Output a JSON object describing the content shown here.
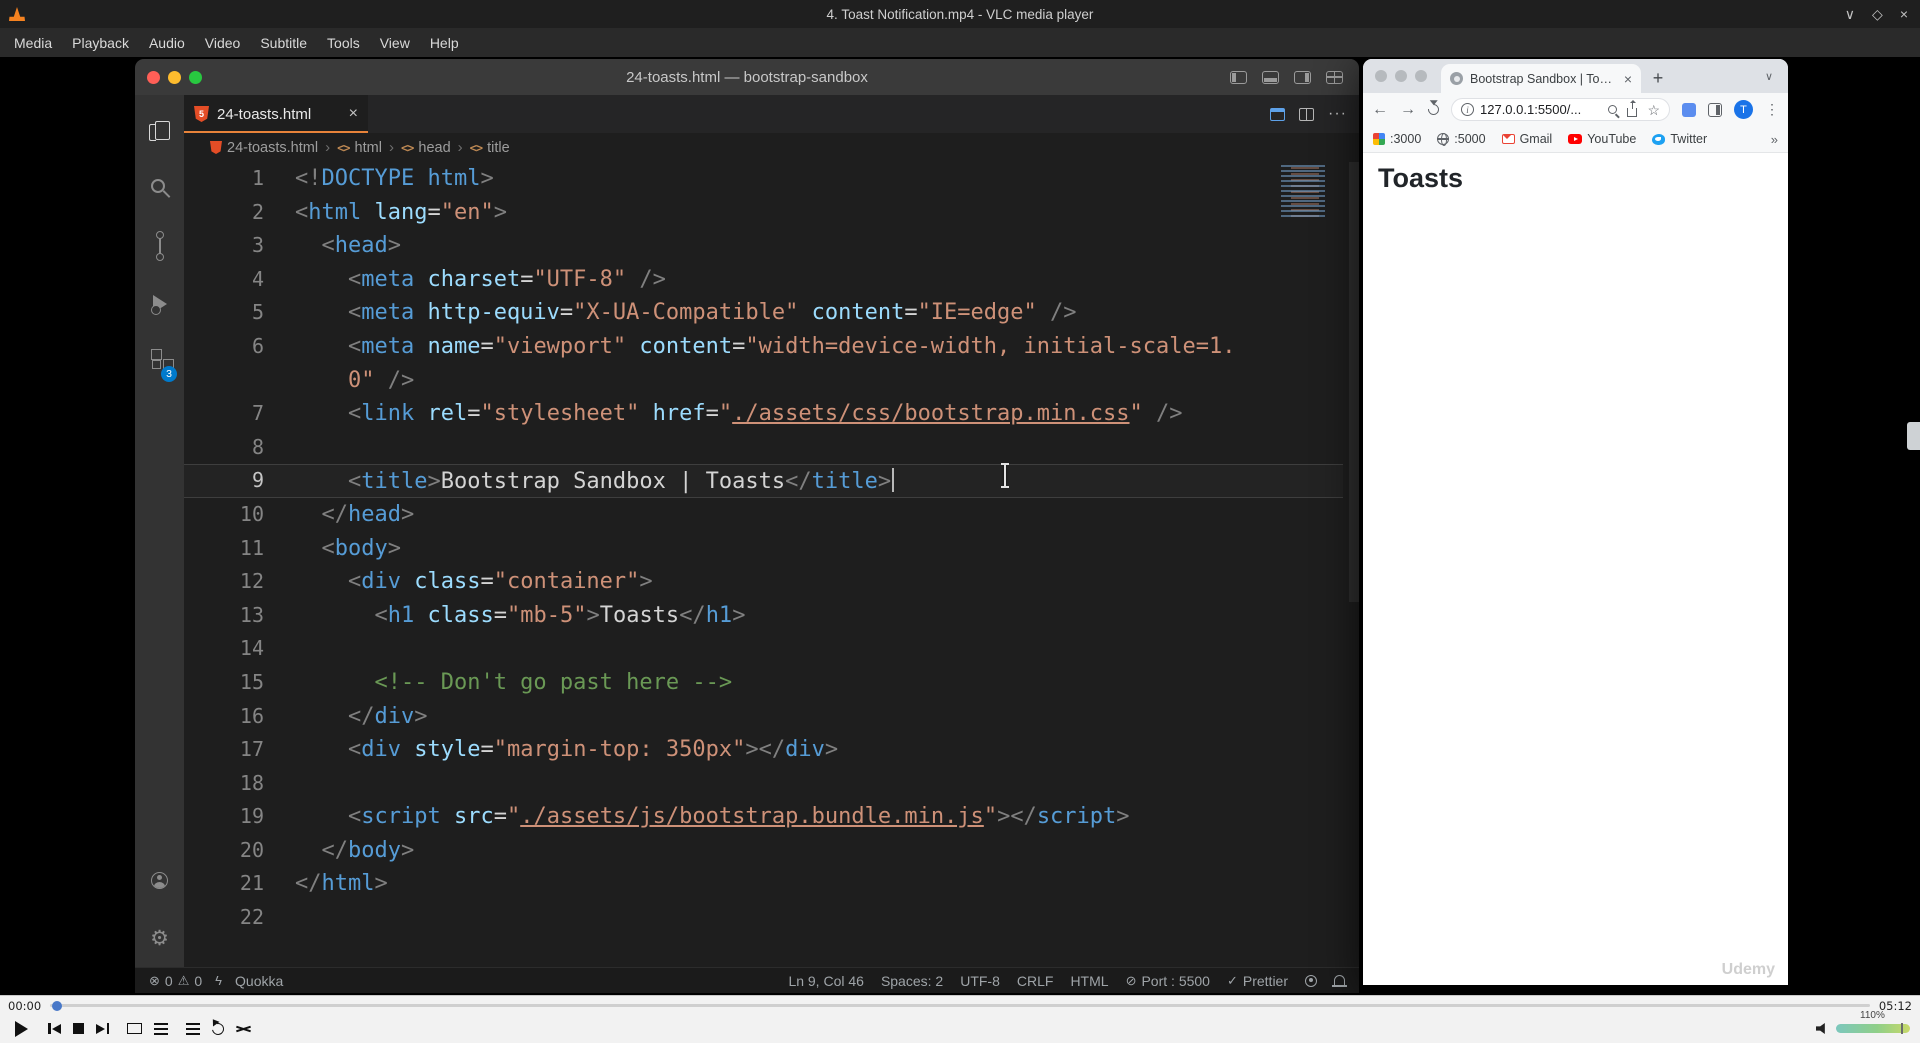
{
  "colors": {
    "tab-accent": "#e8833a",
    "badge-blue": "#007acc",
    "html-orange": "#e44d26",
    "avatar-blue": "#1a73e8",
    "youtube-red": "#ff0000",
    "twitter-blue": "#1da1f2",
    "gmail-red": "#ea4335",
    "cone-orange": "#f58220"
  },
  "vlc": {
    "window_title": "4. Toast Notification.mp4 - VLC media player",
    "menu": [
      "Media",
      "Playback",
      "Audio",
      "Video",
      "Subtitle",
      "Tools",
      "View",
      "Help"
    ],
    "window_controls": {
      "minimize": "∨",
      "maximize": "◇",
      "close": "×"
    },
    "time_elapsed": "00:00",
    "time_total": "05:12",
    "volume": "110%"
  },
  "vscode": {
    "window_title": "24-toasts.html — bootstrap-sandbox",
    "tab_label": "24-toasts.html",
    "breadcrumb": [
      "24-toasts.html",
      "html",
      "head",
      "title"
    ],
    "breadcrumb_separator": "›",
    "breadcrumb_tag_glyph": "<>",
    "extensions_badge": "3",
    "icons": {
      "close": "×",
      "more": "···",
      "gear": "⚙",
      "html5": "5"
    },
    "status_icons": {
      "error": "⊗",
      "warning": "⚠",
      "lightning": "ϟ",
      "circle-slash": "⊘",
      "check": "✓"
    },
    "status": {
      "errors": "0",
      "warnings": "0",
      "quokka": "Quokka",
      "right": [
        {
          "label": "Ln 9, Col 46"
        },
        {
          "label": "Spaces: 2"
        },
        {
          "label": "UTF-8"
        },
        {
          "label": "CRLF"
        },
        {
          "label": "HTML"
        },
        {
          "label": "Port : 5500",
          "icon": "circle-slash"
        },
        {
          "label": "Prettier",
          "icon": "check"
        }
      ]
    },
    "editor": {
      "rows": [
        {
          "n": "1",
          "t": [
            [
              "<!",
              "p"
            ],
            [
              "DOCTYPE html",
              "g"
            ],
            [
              ">",
              "p"
            ]
          ]
        },
        {
          "n": "2",
          "t": [
            [
              "<",
              "p"
            ],
            [
              "html",
              "g"
            ],
            [
              " ",
              "w"
            ],
            [
              "lang",
              "a"
            ],
            [
              "=",
              "w"
            ],
            [
              "\"en\"",
              "s"
            ],
            [
              ">",
              "p"
            ]
          ]
        },
        {
          "n": "3",
          "t": [
            [
              "  ",
              "w"
            ],
            [
              "<",
              "p"
            ],
            [
              "head",
              "g"
            ],
            [
              ">",
              "p"
            ]
          ]
        },
        {
          "n": "4",
          "t": [
            [
              "    ",
              "w"
            ],
            [
              "<",
              "p"
            ],
            [
              "meta",
              "g"
            ],
            [
              " ",
              "w"
            ],
            [
              "charset",
              "a"
            ],
            [
              "=",
              "w"
            ],
            [
              "\"UTF-8\"",
              "s"
            ],
            [
              " ",
              "w"
            ],
            [
              "/>",
              "p"
            ]
          ]
        },
        {
          "n": "5",
          "t": [
            [
              "    ",
              "w"
            ],
            [
              "<",
              "p"
            ],
            [
              "meta",
              "g"
            ],
            [
              " ",
              "w"
            ],
            [
              "http-equiv",
              "a"
            ],
            [
              "=",
              "w"
            ],
            [
              "\"X-UA-Compatible\"",
              "s"
            ],
            [
              " ",
              "w"
            ],
            [
              "content",
              "a"
            ],
            [
              "=",
              "w"
            ],
            [
              "\"IE=edge\"",
              "s"
            ],
            [
              " ",
              "w"
            ],
            [
              "/>",
              "p"
            ]
          ]
        },
        {
          "n": "6",
          "t": [
            [
              "    ",
              "w"
            ],
            [
              "<",
              "p"
            ],
            [
              "meta",
              "g"
            ],
            [
              " ",
              "w"
            ],
            [
              "name",
              "a"
            ],
            [
              "=",
              "w"
            ],
            [
              "\"viewport\"",
              "s"
            ],
            [
              " ",
              "w"
            ],
            [
              "content",
              "a"
            ],
            [
              "=",
              "w"
            ],
            [
              "\"width=device-width, initial-scale=1.",
              "s"
            ]
          ]
        },
        {
          "n": "",
          "t": [
            [
              "    ",
              "w"
            ],
            [
              "0\"",
              "s"
            ],
            [
              " ",
              "w"
            ],
            [
              "/>",
              "p"
            ]
          ]
        },
        {
          "n": "7",
          "t": [
            [
              "    ",
              "w"
            ],
            [
              "<",
              "p"
            ],
            [
              "link",
              "g"
            ],
            [
              " ",
              "w"
            ],
            [
              "rel",
              "a"
            ],
            [
              "=",
              "w"
            ],
            [
              "\"stylesheet\"",
              "s"
            ],
            [
              " ",
              "w"
            ],
            [
              "href",
              "a"
            ],
            [
              "=",
              "w"
            ],
            [
              "\"",
              "s"
            ],
            [
              "./assets/css/bootstrap.min.css",
              "l"
            ],
            [
              "\"",
              "s"
            ],
            [
              " ",
              "w"
            ],
            [
              "/>",
              "p"
            ]
          ]
        },
        {
          "n": "8",
          "t": []
        },
        {
          "n": "9",
          "active": true,
          "cursor": true,
          "t": [
            [
              "    ",
              "w"
            ],
            [
              "<",
              "p"
            ],
            [
              "title",
              "g"
            ],
            [
              ">",
              "p"
            ],
            [
              "Bootstrap Sandbox | Toasts",
              "x"
            ],
            [
              "</",
              "p"
            ],
            [
              "title",
              "g"
            ],
            [
              ">",
              "p"
            ]
          ]
        },
        {
          "n": "10",
          "t": [
            [
              "  ",
              "w"
            ],
            [
              "</",
              "p"
            ],
            [
              "head",
              "g"
            ],
            [
              ">",
              "p"
            ]
          ]
        },
        {
          "n": "11",
          "t": [
            [
              "  ",
              "w"
            ],
            [
              "<",
              "p"
            ],
            [
              "body",
              "g"
            ],
            [
              ">",
              "p"
            ]
          ]
        },
        {
          "n": "12",
          "t": [
            [
              "    ",
              "w"
            ],
            [
              "<",
              "p"
            ],
            [
              "div",
              "g"
            ],
            [
              " ",
              "w"
            ],
            [
              "class",
              "a"
            ],
            [
              "=",
              "w"
            ],
            [
              "\"container\"",
              "s"
            ],
            [
              ">",
              "p"
            ]
          ]
        },
        {
          "n": "13",
          "t": [
            [
              "      ",
              "w"
            ],
            [
              "<",
              "p"
            ],
            [
              "h1",
              "g"
            ],
            [
              " ",
              "w"
            ],
            [
              "class",
              "a"
            ],
            [
              "=",
              "w"
            ],
            [
              "\"mb-5\"",
              "s"
            ],
            [
              ">",
              "p"
            ],
            [
              "Toasts",
              "x"
            ],
            [
              "</",
              "p"
            ],
            [
              "h1",
              "g"
            ],
            [
              ">",
              "p"
            ]
          ]
        },
        {
          "n": "14",
          "t": []
        },
        {
          "n": "15",
          "t": [
            [
              "      ",
              "w"
            ],
            [
              "<!-- Don't go past here -->",
              "c"
            ]
          ]
        },
        {
          "n": "16",
          "t": [
            [
              "    ",
              "w"
            ],
            [
              "</",
              "p"
            ],
            [
              "div",
              "g"
            ],
            [
              ">",
              "p"
            ]
          ]
        },
        {
          "n": "17",
          "t": [
            [
              "    ",
              "w"
            ],
            [
              "<",
              "p"
            ],
            [
              "div",
              "g"
            ],
            [
              " ",
              "w"
            ],
            [
              "style",
              "a"
            ],
            [
              "=",
              "w"
            ],
            [
              "\"margin-top: 350px\"",
              "s"
            ],
            [
              ">",
              "p"
            ],
            [
              "</",
              "p"
            ],
            [
              "div",
              "g"
            ],
            [
              ">",
              "p"
            ]
          ]
        },
        {
          "n": "18",
          "t": []
        },
        {
          "n": "19",
          "t": [
            [
              "    ",
              "w"
            ],
            [
              "<",
              "p"
            ],
            [
              "script",
              "g"
            ],
            [
              " ",
              "w"
            ],
            [
              "src",
              "a"
            ],
            [
              "=",
              "w"
            ],
            [
              "\"",
              "s"
            ],
            [
              "./assets/js/bootstrap.bundle.min.js",
              "l"
            ],
            [
              "\"",
              "s"
            ],
            [
              ">",
              "p"
            ],
            [
              "</",
              "p"
            ],
            [
              "script",
              "g"
            ],
            [
              ">",
              "p"
            ]
          ]
        },
        {
          "n": "20",
          "t": [
            [
              "  ",
              "w"
            ],
            [
              "</",
              "p"
            ],
            [
              "body",
              "g"
            ],
            [
              ">",
              "p"
            ]
          ]
        },
        {
          "n": "21",
          "t": [
            [
              "</",
              "p"
            ],
            [
              "html",
              "g"
            ],
            [
              ">",
              "p"
            ]
          ]
        },
        {
          "n": "22",
          "t": []
        }
      ]
    }
  },
  "browser": {
    "tab_title": "Bootstrap Sandbox | Toasts",
    "url": "127.0.0.1:5500/...",
    "avatar_initial": "T",
    "icons": {
      "close": "×",
      "new_tab": "+",
      "tab_search": "∨",
      "back": "←",
      "forward": "→",
      "info": "i",
      "star": "☆",
      "menu": "⋮",
      "overflow": "»"
    },
    "bookmarks": [
      {
        "label": ":3000",
        "icon": "grid-icon"
      },
      {
        "label": ":5000",
        "icon": "globe-icon"
      },
      {
        "label": "Gmail",
        "icon": "gmail-icon"
      },
      {
        "label": "YouTube",
        "icon": "youtube-icon"
      },
      {
        "label": "Twitter",
        "icon": "twitter-icon"
      }
    ],
    "page_heading": "Toasts",
    "watermark": "Udemy"
  }
}
